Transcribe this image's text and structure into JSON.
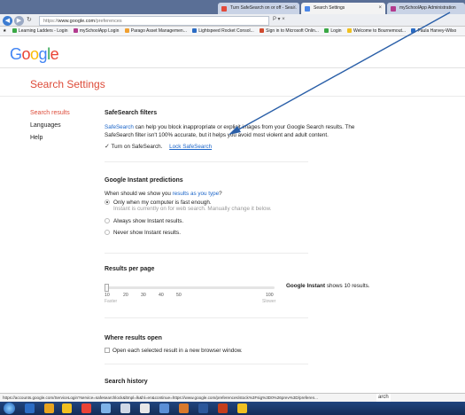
{
  "browser": {
    "tabs": [
      {
        "label": "Turn SafeSearch on or off - Sea...",
        "active": false,
        "favicon_color": "#e24a3b"
      },
      {
        "label": "Search Settings",
        "active": true,
        "favicon_color": "#4a86e8"
      },
      {
        "label": "mySchoolApp Administration",
        "active": false,
        "favicon_color": "#b23a8e"
      }
    ],
    "url_prefix": "https://",
    "url_domain": "www.google.com",
    "url_path": "/preferences",
    "address_icons": "P ▾ ×",
    "bookmarks": [
      {
        "label": "Learning Ladders - Login",
        "color": "#3aa845"
      },
      {
        "label": "mySchoolApp Login",
        "color": "#b23a8e"
      },
      {
        "label": "Parago Asset Managemen...",
        "color": "#f0a030"
      },
      {
        "label": "Lightspeed Rocket Consol...",
        "color": "#2b6cc4"
      },
      {
        "label": "Sign in to Microsoft Onlin...",
        "color": "#d04a2e"
      },
      {
        "label": "Login",
        "color": "#3aa845"
      },
      {
        "label": "Welcome to Bournemout...",
        "color": "#f0c020"
      },
      {
        "label": "Paula Harvey-Wilso",
        "color": "#2b6cc4"
      }
    ]
  },
  "page": {
    "logo": "Google",
    "title": "Search Settings",
    "sidebar": [
      "Search results",
      "Languages",
      "Help"
    ]
  },
  "safesearch": {
    "heading": "SafeSearch filters",
    "link": "SafeSearch",
    "desc1": " can help you block inappropriate or explicit images from your Google Search results. The",
    "desc2": "SafeSearch filter isn't 100% accurate, but it helps you avoid most violent and adult content.",
    "checkbox_label": "Turn on SafeSearch",
    "lock_link": "Lock SafeSearch"
  },
  "instant": {
    "heading": "Google Instant predictions",
    "question_prefix": "When should we show you ",
    "question_link": "results as you type",
    "question_suffix": "?",
    "options": [
      "Only when my computer is fast enough.",
      "Always show Instant results.",
      "Never show Instant results."
    ],
    "selected_index": 0,
    "note": "Instant is currently on for web search. Manually change it below."
  },
  "results_per_page": {
    "heading": "Results per page",
    "ticks": [
      "10",
      "20",
      "30",
      "40",
      "50",
      "100"
    ],
    "left_label": "Faster",
    "right_label": "Slower",
    "value": 10,
    "note_bold": "Google Instant",
    "note_rest": " shows 10 results."
  },
  "where_open": {
    "heading": "Where results open",
    "checkbox_label": "Open each selected result in a new browser window."
  },
  "history": {
    "heading": "Search history"
  },
  "status_url": "https://accounts.google.com/ServiceLogin?service=safesearchlock&ltmpl=lk&hl=en&continue=https://www.google.com/preferences/stock%3Fsig%3D0%26prev%3D/preferen...",
  "status_tail": "arch"
}
